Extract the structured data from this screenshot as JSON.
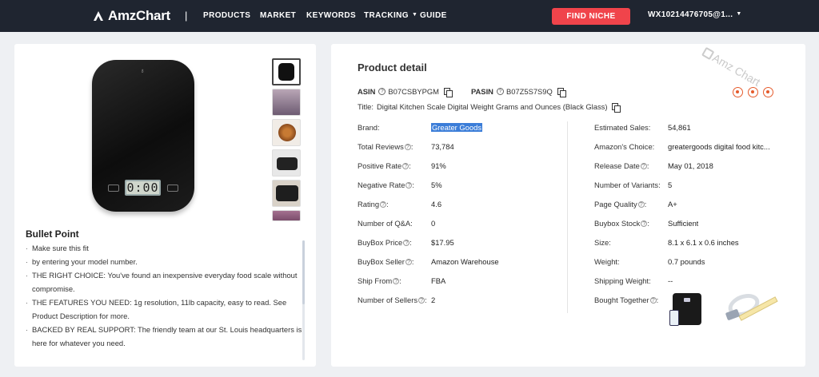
{
  "nav": {
    "logo": "AmzChart",
    "separator": "|",
    "items": [
      {
        "label": "PRODUCTS"
      },
      {
        "label": "MARKET"
      },
      {
        "label": "KEYWORDS"
      },
      {
        "label": "TRACKING",
        "has_dropdown": true
      },
      {
        "label": "GUIDE"
      }
    ],
    "find_niche": "FIND NICHE",
    "user": "WX10214476705@1..."
  },
  "colors": {
    "topbar": "#1f2530",
    "accent": "#f0444b",
    "tool_icons": "#e55b2c",
    "selection": "#3b7dd8"
  },
  "product": {
    "main_image": "black-digital-kitchen-scale",
    "display_reading": "0:00",
    "thumbnails": [
      {
        "icon": "scale-front-thumb"
      },
      {
        "icon": "kitchen-scene-thumb"
      },
      {
        "icon": "food-bowl-thumb"
      },
      {
        "icon": "scale-side-thumb"
      },
      {
        "icon": "scale-food-thumb"
      },
      {
        "icon": "lifestyle-thumb"
      }
    ],
    "bullet_title": "Bullet Point",
    "bullets": [
      "Make sure this fit",
      "by entering your model number.",
      "THE RIGHT CHOICE: You've found an inexpensive everyday food scale without compromise.",
      "THE FEATURES YOU NEED: 1g resolution, 11lb capacity, easy to read. See Product Description for more.",
      "BACKED BY REAL SUPPORT: The friendly team at our St. Louis headquarters is here for whatever you need."
    ]
  },
  "detail": {
    "heading": "Product detail",
    "watermark": "Amz Chart",
    "asin_label": "ASIN",
    "asin": "B07CSBYPGM",
    "pasin_label": "PASIN",
    "pasin": "B07Z5S7S9Q",
    "title_label": "Title:",
    "title": "Digital Kitchen Scale Digital Weight Grams and Ounces (Black Glass)",
    "left": [
      {
        "label": "Brand:",
        "value": "Greater Goods",
        "help": false
      },
      {
        "label": "Total Reviews",
        "value": "73,784",
        "help": true
      },
      {
        "label": "Positive Rate",
        "value": "91%",
        "help": true
      },
      {
        "label": "Negative Rate",
        "value": "5%",
        "help": true
      },
      {
        "label": "Rating",
        "value": "4.6",
        "help": true
      },
      {
        "label": "Number of Q&A:",
        "value": "0",
        "help": false
      },
      {
        "label": "BuyBox Price",
        "value": "$17.95",
        "help": true
      },
      {
        "label": "BuyBox Seller",
        "value": "Amazon Warehouse",
        "help": true
      },
      {
        "label": "Ship From",
        "value": "FBA",
        "help": true
      },
      {
        "label": "Number of Sellers",
        "value": "2",
        "help": true
      }
    ],
    "right": [
      {
        "label": "Estimated Sales:",
        "value": "54,861",
        "help": false
      },
      {
        "label": "Amazon's Choice:",
        "value": "greatergoods digital food kitc...",
        "help": false
      },
      {
        "label": "Release Date",
        "value": "May 01, 2018",
        "help": true
      },
      {
        "label": "Number of Variants:",
        "value": "5",
        "help": false
      },
      {
        "label": "Page Quality",
        "value": "A+",
        "help": true
      },
      {
        "label": "Buybox Stock",
        "value": "Sufficient",
        "help": true
      },
      {
        "label": "Size:",
        "value": "8.1 x 6.1 x 0.6 inches",
        "help": false
      },
      {
        "label": "Weight:",
        "value": "0.7 pounds",
        "help": false
      },
      {
        "label": "Shipping Weight:",
        "value": "--",
        "help": false
      },
      {
        "label": "Bought Together",
        "value": "",
        "help": true
      }
    ],
    "bought_together": [
      {
        "icon": "smart-body-scale"
      },
      {
        "icon": "measuring-tape"
      }
    ]
  }
}
